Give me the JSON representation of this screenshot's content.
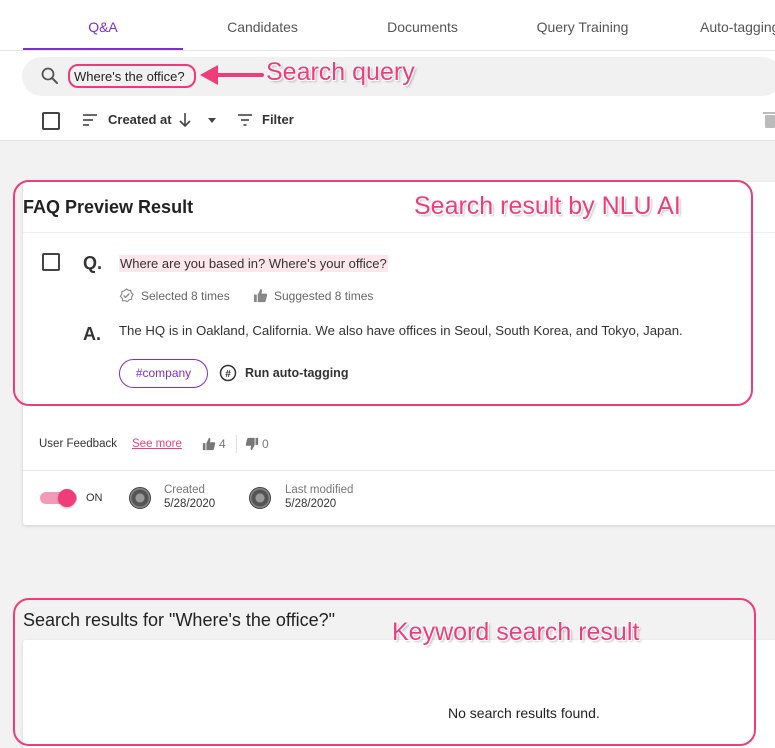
{
  "tabs": [
    {
      "label": "Q&A",
      "active": true
    },
    {
      "label": "Candidates"
    },
    {
      "label": "Documents"
    },
    {
      "label": "Query Training"
    },
    {
      "label": "Auto-tagging"
    }
  ],
  "search": {
    "value": "Where's the office?"
  },
  "toolbar": {
    "sort_label": "Created at",
    "filter_label": "Filter"
  },
  "faq": {
    "title": "FAQ Preview Result",
    "q_letter": "Q.",
    "question": "Where are you based in? Where's your office?",
    "selected": "Selected 8 times",
    "suggested": "Suggested 8 times",
    "a_letter": "A.",
    "answer": "The HQ is in Oakland, California. We also have offices in Seoul, South Korea, and Tokyo, Japan.",
    "tag": "#company",
    "autotag_label": "Run auto-tagging",
    "feedback_label": "User Feedback",
    "see_more": "See more",
    "thumbs_up": "4",
    "thumbs_down": "0",
    "toggle_label": "ON",
    "created_label": "Created",
    "created_date": "5/28/2020",
    "modified_label": "Last modified",
    "modified_date": "5/28/2020"
  },
  "keyword": {
    "title": "Search results for \"Where's the office?\"",
    "empty": "No search results found."
  },
  "annotations": {
    "search_query": "Search query",
    "nlu": "Search result by NLU AI",
    "keyword": "Keyword search result"
  },
  "colors": {
    "accent": "#7b2fd6",
    "annotation": "#ee3d78",
    "toggle": "#ee3d78"
  }
}
